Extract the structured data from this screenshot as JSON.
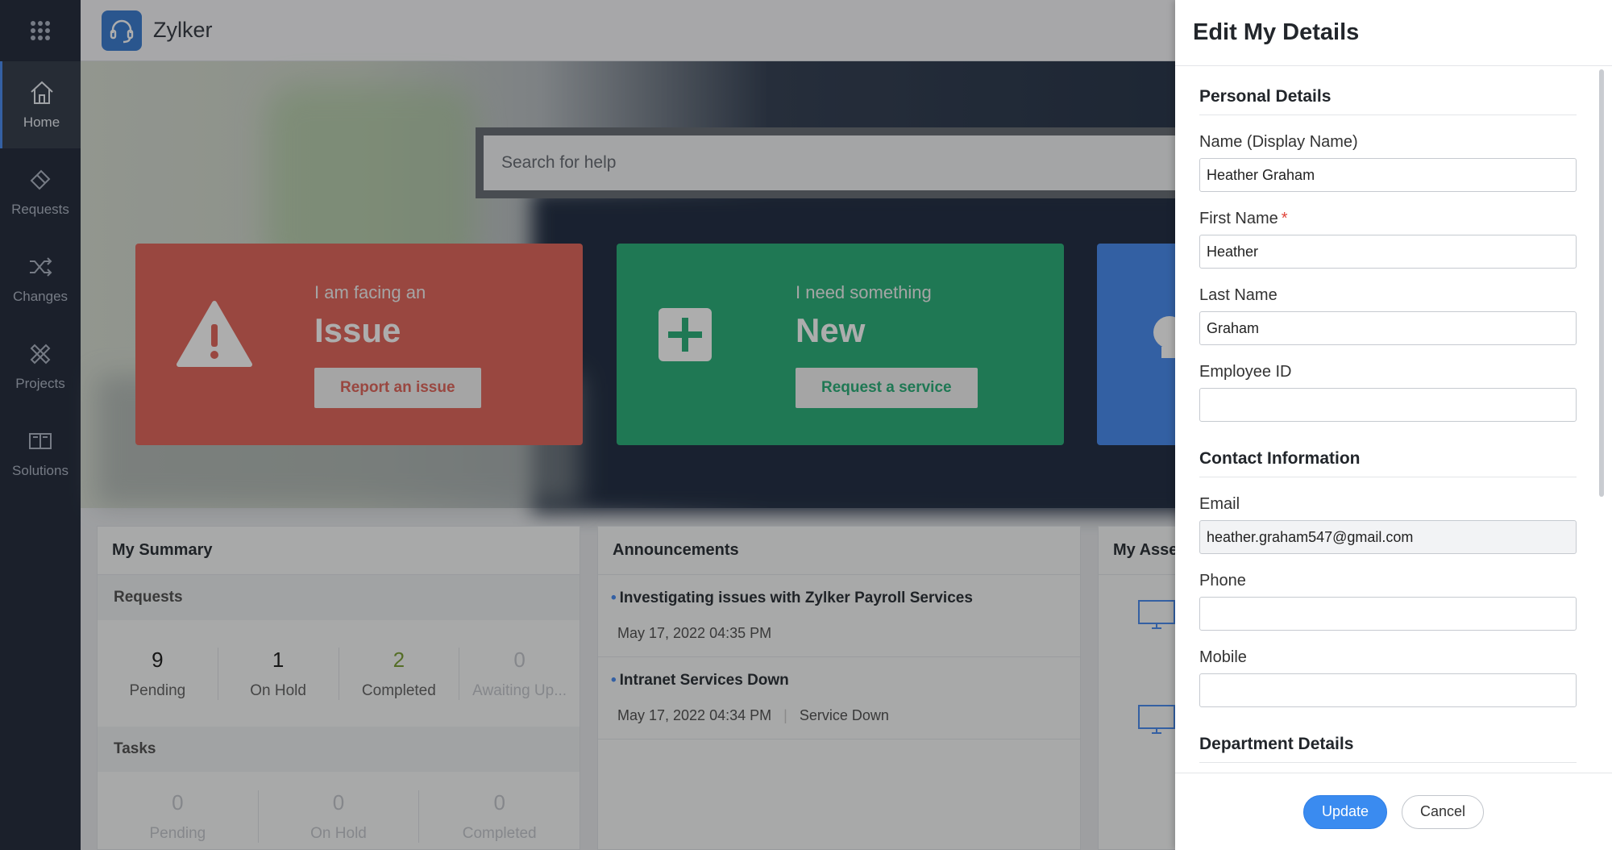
{
  "app": {
    "brand": "Zylker"
  },
  "sidebar": {
    "items": [
      {
        "label": "Home",
        "icon": "home-icon",
        "active": true
      },
      {
        "label": "Requests",
        "icon": "ticket-icon"
      },
      {
        "label": "Changes",
        "icon": "shuffle-icon"
      },
      {
        "label": "Projects",
        "icon": "projects-icon"
      },
      {
        "label": "Solutions",
        "icon": "book-icon"
      }
    ]
  },
  "search": {
    "placeholder": "Search for help"
  },
  "cards": {
    "issue": {
      "caption": "I am facing an",
      "title": "Issue",
      "cta": "Report an issue"
    },
    "service": {
      "caption": "I need something",
      "title": "New",
      "cta": "Request a service"
    }
  },
  "summary": {
    "title": "My Summary",
    "requests_header": "Requests",
    "requests": [
      {
        "count": "9",
        "label": "Pending"
      },
      {
        "count": "1",
        "label": "On Hold"
      },
      {
        "count": "2",
        "label": "Completed"
      },
      {
        "count": "0",
        "label": "Awaiting Up..."
      }
    ],
    "tasks_header": "Tasks",
    "tasks": [
      {
        "count": "0",
        "label": "Pending"
      },
      {
        "count": "0",
        "label": "On Hold"
      },
      {
        "count": "0",
        "label": "Completed"
      }
    ]
  },
  "announcements": {
    "title": "Announcements",
    "items": [
      {
        "title": "Investigating issues with Zylker Payroll Services",
        "date": "May 17, 2022 04:35 PM",
        "tag": ""
      },
      {
        "title": "Intranet Services Down",
        "date": "May 17, 2022 04:34 PM",
        "tag": "Service Down"
      }
    ]
  },
  "assets": {
    "title": "My Asse"
  },
  "drawer": {
    "title": "Edit My Details",
    "personal_header": "Personal Details",
    "display_name_label": "Name (Display Name)",
    "display_name": "Heather Graham",
    "first_name_label": "First Name",
    "first_name": "Heather",
    "last_name_label": "Last Name",
    "last_name": "Graham",
    "employee_id_label": "Employee ID",
    "employee_id": "",
    "contact_header": "Contact Information",
    "email_label": "Email",
    "email": "heather.graham547@gmail.com",
    "phone_label": "Phone",
    "phone": "",
    "mobile_label": "Mobile",
    "mobile": "",
    "department_header": "Department Details",
    "update_label": "Update",
    "cancel_label": "Cancel"
  },
  "colors": {
    "accent": "#3a8bf0",
    "issue": "#e2695f",
    "service": "#2fb27c",
    "rail": "#283040"
  }
}
